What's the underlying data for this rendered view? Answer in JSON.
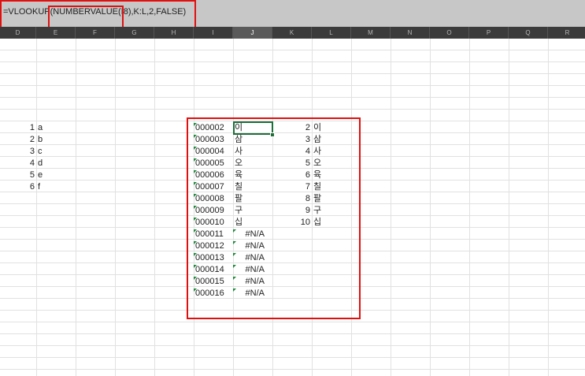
{
  "formula_bar": {
    "formula": "=VLOOKUP(NUMBERVALUE(I8),K:L,2,FALSE)"
  },
  "columns": [
    "D",
    "E",
    "F",
    "G",
    "H",
    "I",
    "J",
    "K",
    "L",
    "M",
    "N",
    "O",
    "P",
    "Q",
    "R"
  ],
  "selected_column": "J",
  "left_table": [
    {
      "num": "1",
      "letter": "a"
    },
    {
      "num": "2",
      "letter": "b"
    },
    {
      "num": "3",
      "letter": "c"
    },
    {
      "num": "4",
      "letter": "d"
    },
    {
      "num": "5",
      "letter": "e"
    },
    {
      "num": "6",
      "letter": "f"
    }
  ],
  "codes": [
    "000002",
    "000003",
    "000004",
    "000005",
    "000006",
    "000007",
    "000008",
    "000009",
    "000010",
    "000011",
    "000012",
    "000013",
    "000014",
    "000015",
    "000016"
  ],
  "lookup_results": [
    "이",
    "삼",
    "사",
    "오",
    "육",
    "칠",
    "팔",
    "구",
    "십",
    "#N/A",
    "#N/A",
    "#N/A",
    "#N/A",
    "#N/A",
    "#N/A"
  ],
  "lookup_table": [
    {
      "k": "2",
      "l": "이"
    },
    {
      "k": "3",
      "l": "삼"
    },
    {
      "k": "4",
      "l": "사"
    },
    {
      "k": "5",
      "l": "오"
    },
    {
      "k": "6",
      "l": "육"
    },
    {
      "k": "7",
      "l": "칠"
    },
    {
      "k": "8",
      "l": "팔"
    },
    {
      "k": "9",
      "l": "구"
    },
    {
      "k": "10",
      "l": "십"
    }
  ],
  "colors": {
    "highlight": "#e01010",
    "active": "#1e6e3a",
    "error_indicator": "#1e8a3a"
  }
}
